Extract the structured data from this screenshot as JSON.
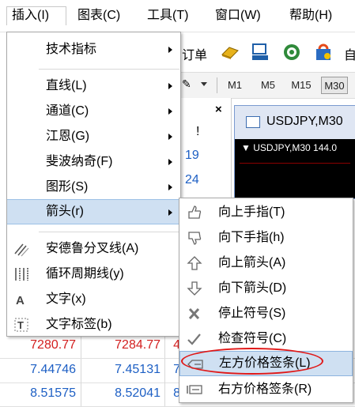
{
  "menubar": {
    "items": [
      "插入(I)",
      "图表(C)",
      "工具(T)",
      "窗口(W)",
      "帮助(H)"
    ]
  },
  "toolbar": {
    "partial_text": "订单",
    "right_text": "自",
    "timeframes": [
      "M1",
      "M5",
      "M15",
      "M30"
    ],
    "active_timeframe": "M30"
  },
  "panel": {
    "close_label": "×",
    "exclaim": "!",
    "values": [
      "19",
      "24"
    ]
  },
  "chart": {
    "title": "USDJPY,M30",
    "inner_label": "▼ USDJPY,M30  144.0"
  },
  "table": {
    "rows": [
      {
        "bid": "7280.77",
        "ask": "7284.77",
        "extra": "4"
      },
      {
        "bid": "7.44746",
        "ask": "7.45131",
        "extra": "7"
      },
      {
        "bid": "8.51575",
        "ask": "8.52041",
        "extra": "8"
      }
    ],
    "bid_color": "#d32020",
    "ask_color": "#d32020",
    "blue_color": "#1d5fc4"
  },
  "insert_menu": {
    "items": [
      {
        "label": "技术指标",
        "submenu": true
      },
      {
        "label": "直线(L)",
        "submenu": true
      },
      {
        "label": "通道(C)",
        "submenu": true
      },
      {
        "label": "江恩(G)",
        "submenu": true
      },
      {
        "label": "斐波纳奇(F)",
        "submenu": true
      },
      {
        "label": "图形(S)",
        "submenu": true
      },
      {
        "label": "箭头(r)",
        "submenu": true,
        "highlighted": true
      },
      {
        "label": "安德鲁分叉线(A)",
        "icon": "andrews-pitchfork-icon"
      },
      {
        "label": "循环周期线(y)",
        "icon": "cycle-lines-icon"
      },
      {
        "label": "文字(x)",
        "icon": "text-icon"
      },
      {
        "label": "文字标签(b)",
        "icon": "text-label-icon"
      }
    ]
  },
  "arrows_submenu": {
    "items": [
      {
        "label": "向上手指(T)",
        "icon": "thumb-up-icon"
      },
      {
        "label": "向下手指(h)",
        "icon": "thumb-down-icon"
      },
      {
        "label": "向上箭头(A)",
        "icon": "arrow-up-icon"
      },
      {
        "label": "向下箭头(D)",
        "icon": "arrow-down-icon"
      },
      {
        "label": "停止符号(S)",
        "icon": "stop-sign-icon"
      },
      {
        "label": "检查符号(C)",
        "icon": "check-sign-icon"
      },
      {
        "label": "左方价格签条(L)",
        "icon": "left-price-label-icon",
        "highlighted": true
      },
      {
        "label": "右方价格签条(R)",
        "icon": "right-price-label-icon"
      }
    ]
  }
}
